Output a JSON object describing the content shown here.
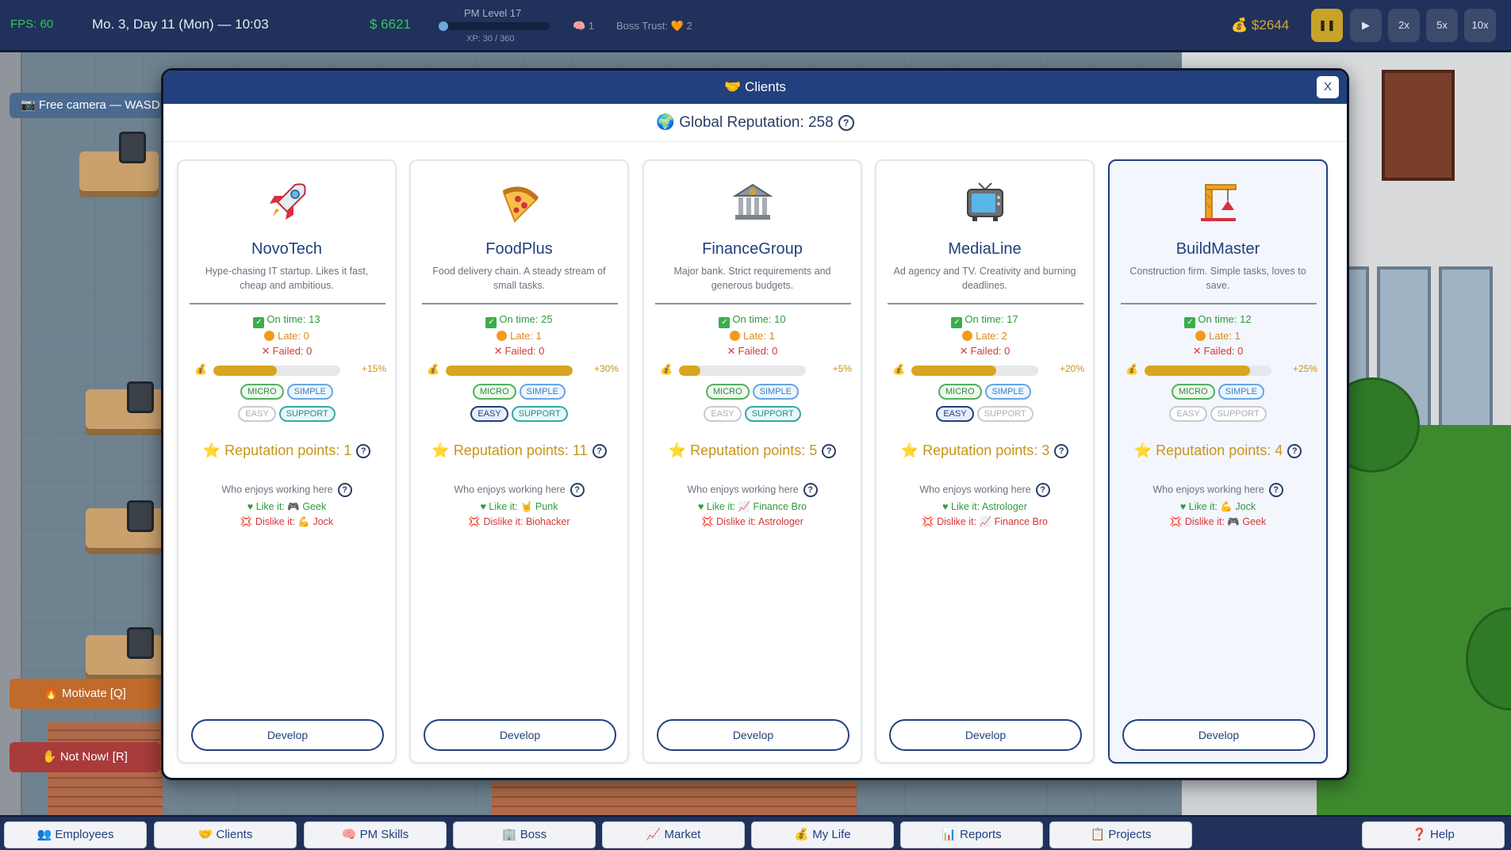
{
  "hud": {
    "fps": "FPS: 60",
    "date": "Mo. 3, Day 11 (Mon) — 10:03",
    "money": "$ 6621",
    "pm_level": "PM Level 17",
    "xp_text": "XP: 30 / 360",
    "xp_progress": 0.0833,
    "brain_count": "1",
    "boss_trust_label": "Boss Trust:",
    "boss_trust_value": "2",
    "bank": "$2644",
    "speeds": [
      "2x",
      "5x",
      "10x"
    ]
  },
  "overlay": {
    "free_camera": "📷 Free camera — WASD",
    "motivate": "🔥 Motivate [Q]",
    "not_now": "✋ Not Now! [R]"
  },
  "modal": {
    "title": "🤝 Clients",
    "close": "X",
    "global_reputation": "🌍 Global Reputation: 258",
    "who_label": "Who enjoys working here",
    "develop_label": "Develop",
    "clients": [
      {
        "icon": "rocket-icon",
        "name": "NovoTech",
        "desc": "Hype-chasing IT startup. Likes it fast, cheap and ambitious.",
        "on_time": "On time: 13",
        "late": "Late: 0",
        "failed": "Failed: 0",
        "progress": 0.5,
        "pct": "+15%",
        "tags_row1": [
          {
            "label": "MICRO",
            "style": "t-micro"
          },
          {
            "label": "SIMPLE",
            "style": "t-simple"
          }
        ],
        "tags_row2": [
          {
            "label": "EASY",
            "style": "t-off"
          },
          {
            "label": "SUPPORT",
            "style": "t-support"
          }
        ],
        "rep": "Reputation points: 1",
        "like": "Like it: 🎮 Geek",
        "dislike": "Dislike it: 💪 Jock",
        "selected": false
      },
      {
        "icon": "pizza-icon",
        "name": "FoodPlus",
        "desc": "Food delivery chain. A steady stream of small tasks.",
        "on_time": "On time: 25",
        "late": "Late: 1",
        "failed": "Failed: 0",
        "progress": 1.0,
        "pct": "+30%",
        "tags_row1": [
          {
            "label": "MICRO",
            "style": "t-micro"
          },
          {
            "label": "SIMPLE",
            "style": "t-simple"
          }
        ],
        "tags_row2": [
          {
            "label": "EASY",
            "style": "t-easy-on"
          },
          {
            "label": "SUPPORT",
            "style": "t-support"
          }
        ],
        "rep": "Reputation points: 11",
        "like": "Like it: 🤘 Punk",
        "dislike": "Dislike it: Biohacker",
        "selected": false
      },
      {
        "icon": "bank-icon",
        "name": "FinanceGroup",
        "desc": "Major bank. Strict requirements and generous budgets.",
        "on_time": "On time: 10",
        "late": "Late: 1",
        "failed": "Failed: 0",
        "progress": 0.17,
        "pct": "+5%",
        "tags_row1": [
          {
            "label": "MICRO",
            "style": "t-micro"
          },
          {
            "label": "SIMPLE",
            "style": "t-simple"
          }
        ],
        "tags_row2": [
          {
            "label": "EASY",
            "style": "t-off"
          },
          {
            "label": "SUPPORT",
            "style": "t-support"
          }
        ],
        "rep": "Reputation points: 5",
        "like": "Like it: 📈 Finance Bro",
        "dislike": "Dislike it: Astrologer",
        "selected": false
      },
      {
        "icon": "tv-icon",
        "name": "MediaLine",
        "desc": "Ad agency and TV. Creativity and burning deadlines.",
        "on_time": "On time: 17",
        "late": "Late: 2",
        "failed": "Failed: 0",
        "progress": 0.67,
        "pct": "+20%",
        "tags_row1": [
          {
            "label": "MICRO",
            "style": "t-micro"
          },
          {
            "label": "SIMPLE",
            "style": "t-simple"
          }
        ],
        "tags_row2": [
          {
            "label": "EASY",
            "style": "t-easy-on"
          },
          {
            "label": "SUPPORT",
            "style": "t-off"
          }
        ],
        "rep": "Reputation points: 3",
        "like": "Like it: Astrologer",
        "dislike": "Dislike it: 📈 Finance Bro",
        "selected": false
      },
      {
        "icon": "crane-icon",
        "name": "BuildMaster",
        "desc": "Construction firm. Simple tasks, loves to save.",
        "on_time": "On time: 12",
        "late": "Late: 1",
        "failed": "Failed: 0",
        "progress": 0.83,
        "pct": "+25%",
        "tags_row1": [
          {
            "label": "MICRO",
            "style": "t-micro"
          },
          {
            "label": "SIMPLE",
            "style": "t-simple"
          }
        ],
        "tags_row2": [
          {
            "label": "EASY",
            "style": "t-off"
          },
          {
            "label": "SUPPORT",
            "style": "t-off"
          }
        ],
        "rep": "Reputation points: 4",
        "like": "Like it: 💪 Jock",
        "dislike": "Dislike it: 🎮 Geek",
        "selected": true
      }
    ]
  },
  "bottom_nav": [
    {
      "label": "👥 Employees"
    },
    {
      "label": "🤝 Clients"
    },
    {
      "label": "🧠 PM Skills"
    },
    {
      "label": "🏢 Boss"
    },
    {
      "label": "📈 Market"
    },
    {
      "label": "💰 My Life"
    },
    {
      "label": "📊 Reports"
    },
    {
      "label": "📋 Projects"
    },
    {
      "label": "❓ Help"
    }
  ]
}
